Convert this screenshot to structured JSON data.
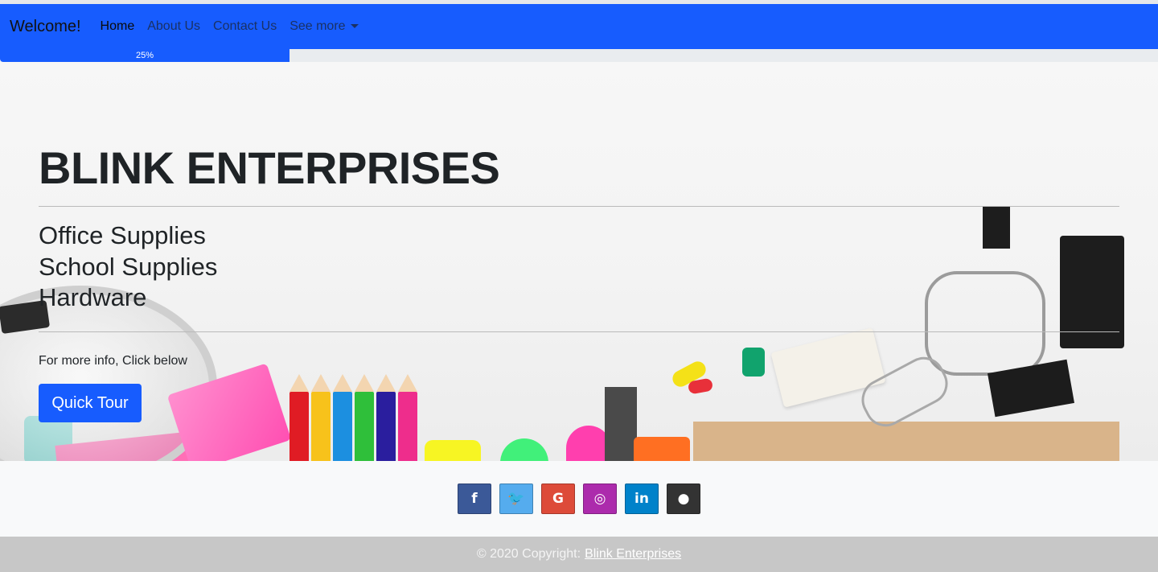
{
  "navbar": {
    "brand": "Welcome!",
    "links": [
      {
        "label": "Home",
        "active": true
      },
      {
        "label": "About Us",
        "active": false
      },
      {
        "label": "Contact Us",
        "active": false
      },
      {
        "label": "See more",
        "dropdown": true
      }
    ],
    "accent_color": "#175cfe"
  },
  "progress": {
    "label": "25%",
    "value": 25
  },
  "hero": {
    "title": "BLINK ENTERPRISES",
    "lines": [
      "Office Supplies",
      "School Supplies",
      "Hardware"
    ],
    "info": "For more info, Click below",
    "button_label": "Quick Tour"
  },
  "social": {
    "icons": [
      {
        "name": "facebook-icon",
        "glyph": "f",
        "color": "#3b5998"
      },
      {
        "name": "twitter-icon",
        "glyph": "🐦",
        "color": "#55acee"
      },
      {
        "name": "google-icon",
        "glyph": "G",
        "color": "#dd4b39"
      },
      {
        "name": "instagram-icon",
        "glyph": "◎",
        "color": "#ac2bac"
      },
      {
        "name": "linkedin-icon",
        "glyph": "in",
        "color": "#0082ca"
      },
      {
        "name": "github-icon",
        "glyph": "●",
        "color": "#333333"
      }
    ]
  },
  "footer": {
    "copyright": "© 2020 Copyright:",
    "link_label": "Blink Enterprises"
  }
}
